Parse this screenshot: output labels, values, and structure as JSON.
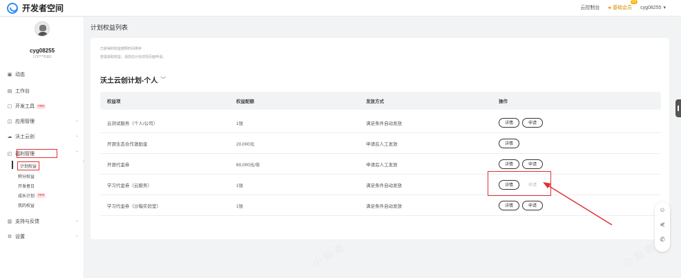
{
  "brand": {
    "name": "开发者空间"
  },
  "topbar": {
    "console": "云控制台",
    "vip": "基础会员",
    "vip_tag": "V1",
    "username": "cyg08255",
    "dropdown_icon": "caret-down-icon"
  },
  "sidebar": {
    "username": "cyg08255",
    "phone": "173****5381",
    "items": [
      {
        "label": "动态",
        "icon": "dynamic-icon"
      },
      {
        "label": "工作台",
        "icon": "desk-icon"
      },
      {
        "label": "开发工具",
        "icon": "tool-icon",
        "badge": "new"
      },
      {
        "label": "应用管理",
        "icon": "app-icon"
      },
      {
        "label": "沃土云创",
        "icon": "cloud-icon"
      },
      {
        "label": "福利管理",
        "icon": "gift-icon"
      },
      {
        "label": "支持与反馈",
        "icon": "feedback-icon"
      },
      {
        "label": "设置",
        "icon": "gear-icon"
      }
    ],
    "sub_items": [
      {
        "label": "计划权益"
      },
      {
        "label": "积分权益"
      },
      {
        "label": "开发者日"
      },
      {
        "label": "成长计划",
        "badge": "new"
      },
      {
        "label": "我的权益"
      }
    ]
  },
  "main": {
    "page_title": "计划权益列表",
    "notice1": "已获得的权益按照时间排序",
    "notice2": "若需获取权益，请前往计划详情页面申请。",
    "plan_title": "沃土云创计划-个人",
    "columns": [
      "权益项",
      "权益配额",
      "发放方式",
      "操作"
    ],
    "rows": [
      {
        "name": "云测试服务（个人/公司）",
        "quota": "1张",
        "method": "满足条件自动发放",
        "actions": [
          "详情",
          "申请"
        ]
      },
      {
        "name": "开源生态合作激励金",
        "quota": "20,000元",
        "method": "申请后人工发放",
        "actions": [
          "详情"
        ]
      },
      {
        "name": "开源代金券",
        "quota": "60,000元/年",
        "method": "申请后人工发放",
        "actions": [
          "详情",
          "申请"
        ]
      },
      {
        "name": "学习代金券（云服务）",
        "quota": "1张",
        "method": "满足条件自动发放",
        "actions": [
          "详情",
          "申请"
        ]
      },
      {
        "name": "学习代金券（沙箱实验室）",
        "quota": "1张",
        "method": "满足条件自动发放",
        "actions": [
          "详情",
          "申请"
        ]
      }
    ]
  },
  "float_tools": {
    "icons": [
      "smile-icon",
      "share-icon",
      "phone-icon"
    ]
  },
  "watermark": "小 指 南"
}
